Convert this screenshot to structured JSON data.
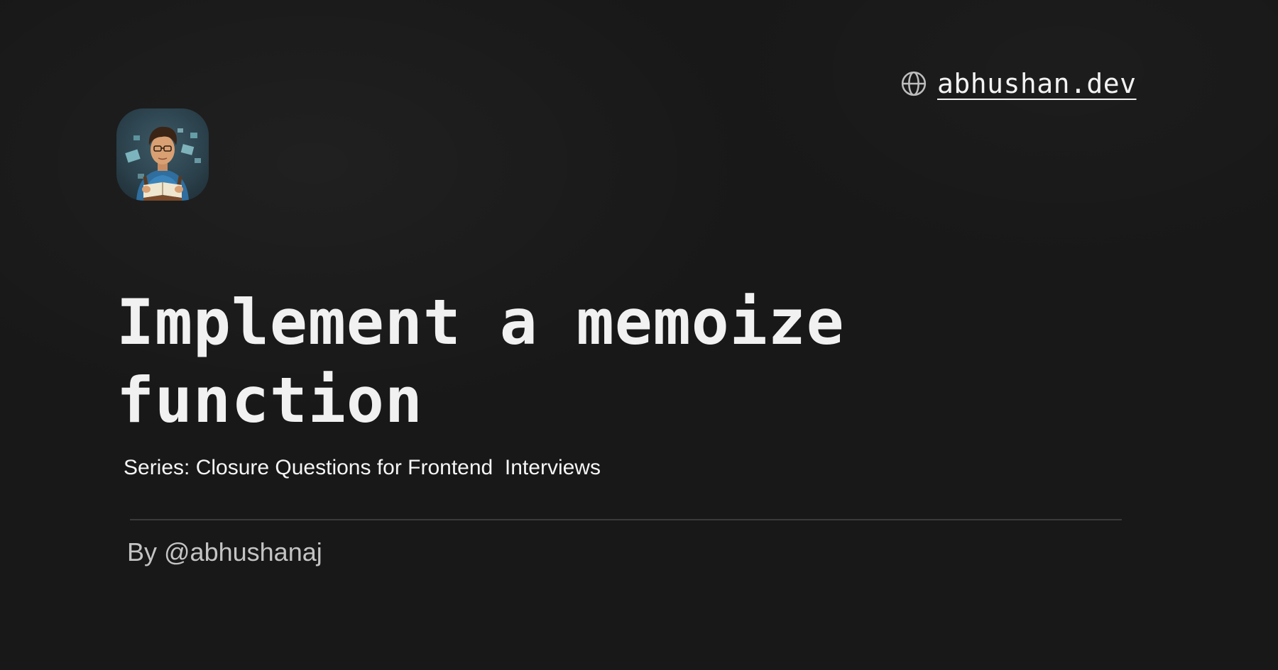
{
  "header": {
    "site_icon": "globe-icon",
    "site_url": "abhushan.dev"
  },
  "avatar": {
    "alt": "Author avatar"
  },
  "main": {
    "title": "Implement a memoize function",
    "series": "Series: Closure Questions for Frontend  Interviews"
  },
  "footer": {
    "byline": "By @abhushanaj"
  },
  "colors": {
    "background": "#181818",
    "text": "#f2f2f2",
    "muted_text": "#c4c4c4",
    "divider": "#3a3a3a"
  }
}
